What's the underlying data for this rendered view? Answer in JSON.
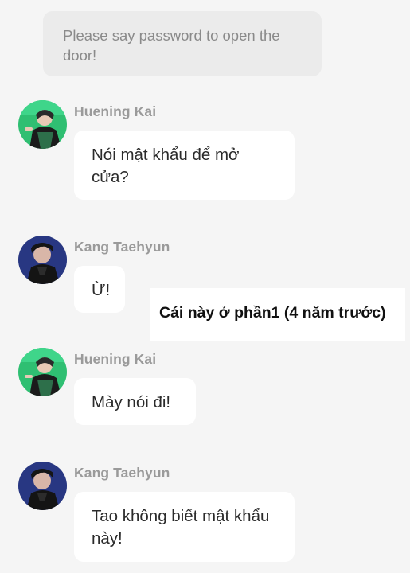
{
  "system_message": {
    "text": "Please say password to open the door!"
  },
  "messages": [
    {
      "sender": "Huening Kai",
      "avatar": "huening-kai-avatar",
      "text": "Nói mật khẩu để mở cửa?"
    },
    {
      "sender": "Kang Taehyun",
      "avatar": "kang-taehyun-avatar",
      "text": "Ừ!"
    },
    {
      "sender": "Huening Kai",
      "avatar": "huening-kai-avatar",
      "text": "Mày nói đi!"
    },
    {
      "sender": "Kang Taehyun",
      "avatar": "kang-taehyun-avatar",
      "text": "Tao không biết mật khẩu này!"
    }
  ],
  "overlay_note": {
    "text": "Cái này ở phần1 (4 năm trước)"
  },
  "colors": {
    "background": "#f5f5f5",
    "system_bubble": "#ebebeb",
    "bubble": "#ffffff",
    "name_text": "#9a9a9a",
    "hk_avatar_bg": "#2fbf72",
    "kt_avatar_bg": "#1f2a6b"
  }
}
